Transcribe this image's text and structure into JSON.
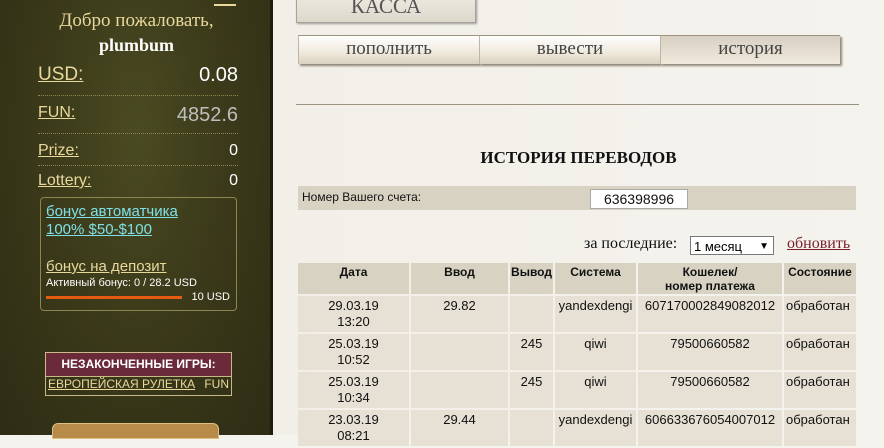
{
  "sidebar": {
    "welcome": "Добро пожаловать,",
    "username": "plumbum",
    "balances": [
      {
        "label": "USD:",
        "value": "0.08"
      },
      {
        "label": "FUN:",
        "value": "4852.6"
      },
      {
        "label": "Prize:",
        "value": "0"
      },
      {
        "label": "Lottery:",
        "value": "0"
      }
    ],
    "bonus_auto_line1": "бонус автоматчика",
    "bonus_auto_line2": "100% $50-$100",
    "bonus_deposit": "бонус на депозит",
    "active_bonus": "Активный бонус: 0 / 28.2 USD",
    "bonus_amount": "10 USD",
    "unfinished_title": "НЕЗАКОНЧЕННЫЕ ИГРЫ:",
    "unfinished_game": "ЕВРОПЕЙСКАЯ РУЛЕТКА",
    "unfinished_currency": "FUN"
  },
  "main": {
    "kassa": "КАССА",
    "tabs": [
      {
        "label": "пополнить",
        "active": false
      },
      {
        "label": "вывести",
        "active": false
      },
      {
        "label": "история",
        "active": true
      }
    ],
    "title": "ИСТОРИЯ ПЕРЕВОДОВ",
    "account_label": "Номер Вашего счета:",
    "account_number": "636398996",
    "period_label": "за последние:",
    "period_value": "1 месяц",
    "refresh": "обновить",
    "table": {
      "headers": [
        "Дата",
        "Ввод",
        "Вывод",
        "Система",
        "Кошелек/",
        "номер платежа",
        "Состояние"
      ],
      "rows": [
        {
          "date": "29.03.19",
          "time": "13:20",
          "in": "29.82",
          "out": "",
          "system": "yandexdengi",
          "wallet": "607170002849082012",
          "status": "обработан"
        },
        {
          "date": "25.03.19",
          "time": "10:52",
          "in": "",
          "out": "245",
          "system": "qiwi",
          "wallet": "79500660582",
          "status": "обработан"
        },
        {
          "date": "25.03.19",
          "time": "10:34",
          "in": "",
          "out": "245",
          "system": "qiwi",
          "wallet": "79500660582",
          "status": "обработан"
        },
        {
          "date": "23.03.19",
          "time": "08:21",
          "in": "29.44",
          "out": "",
          "system": "yandexdengi",
          "wallet": "606633676054007012",
          "status": "обработан"
        }
      ]
    }
  },
  "colors": {
    "sidebar_bg": "#3b3a1a",
    "gold_text": "#e9d89c",
    "bonus_link": "#7fe0e6",
    "refresh_link": "#7a1f2b",
    "table_header": "#d7d2c2",
    "table_cell": "#e6e1d4"
  }
}
